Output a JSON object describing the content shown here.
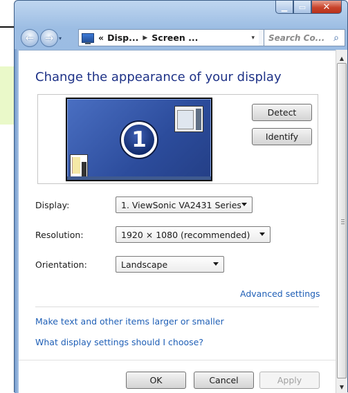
{
  "window": {
    "minimize_icon": "minimize-icon",
    "maximize_icon": "maximize-icon",
    "close_icon": "close-icon"
  },
  "navbar": {
    "back_glyph": "←",
    "forward_glyph": "→",
    "history_glyph": "▾",
    "breadcrumb": {
      "prefix": "«",
      "items": [
        "Disp...",
        "Screen ..."
      ],
      "separator": "▶"
    },
    "dropdown_glyph": "▾",
    "refresh_glyph": "↻",
    "search_placeholder": "Search Co..."
  },
  "content": {
    "title": "Change the appearance of your display",
    "monitor_number": "1",
    "detect_label": "Detect",
    "identify_label": "Identify",
    "display_label": "Display:",
    "display_value": "1. ViewSonic VA2431 Series",
    "resolution_label": "Resolution:",
    "resolution_value": "1920 × 1080 (recommended)",
    "orientation_label": "Orientation:",
    "orientation_value": "Landscape",
    "advanced_link": "Advanced settings",
    "link_text_size": "Make text and other items larger or smaller",
    "link_which_settings": "What display settings should I choose?"
  },
  "footer": {
    "ok_label": "OK",
    "cancel_label": "Cancel",
    "apply_label": "Apply"
  },
  "colors": {
    "title_blue": "#1e3287",
    "link_blue": "#1f5fb6",
    "frame_blue": "#9cbde3",
    "close_red": "#c8432b"
  }
}
